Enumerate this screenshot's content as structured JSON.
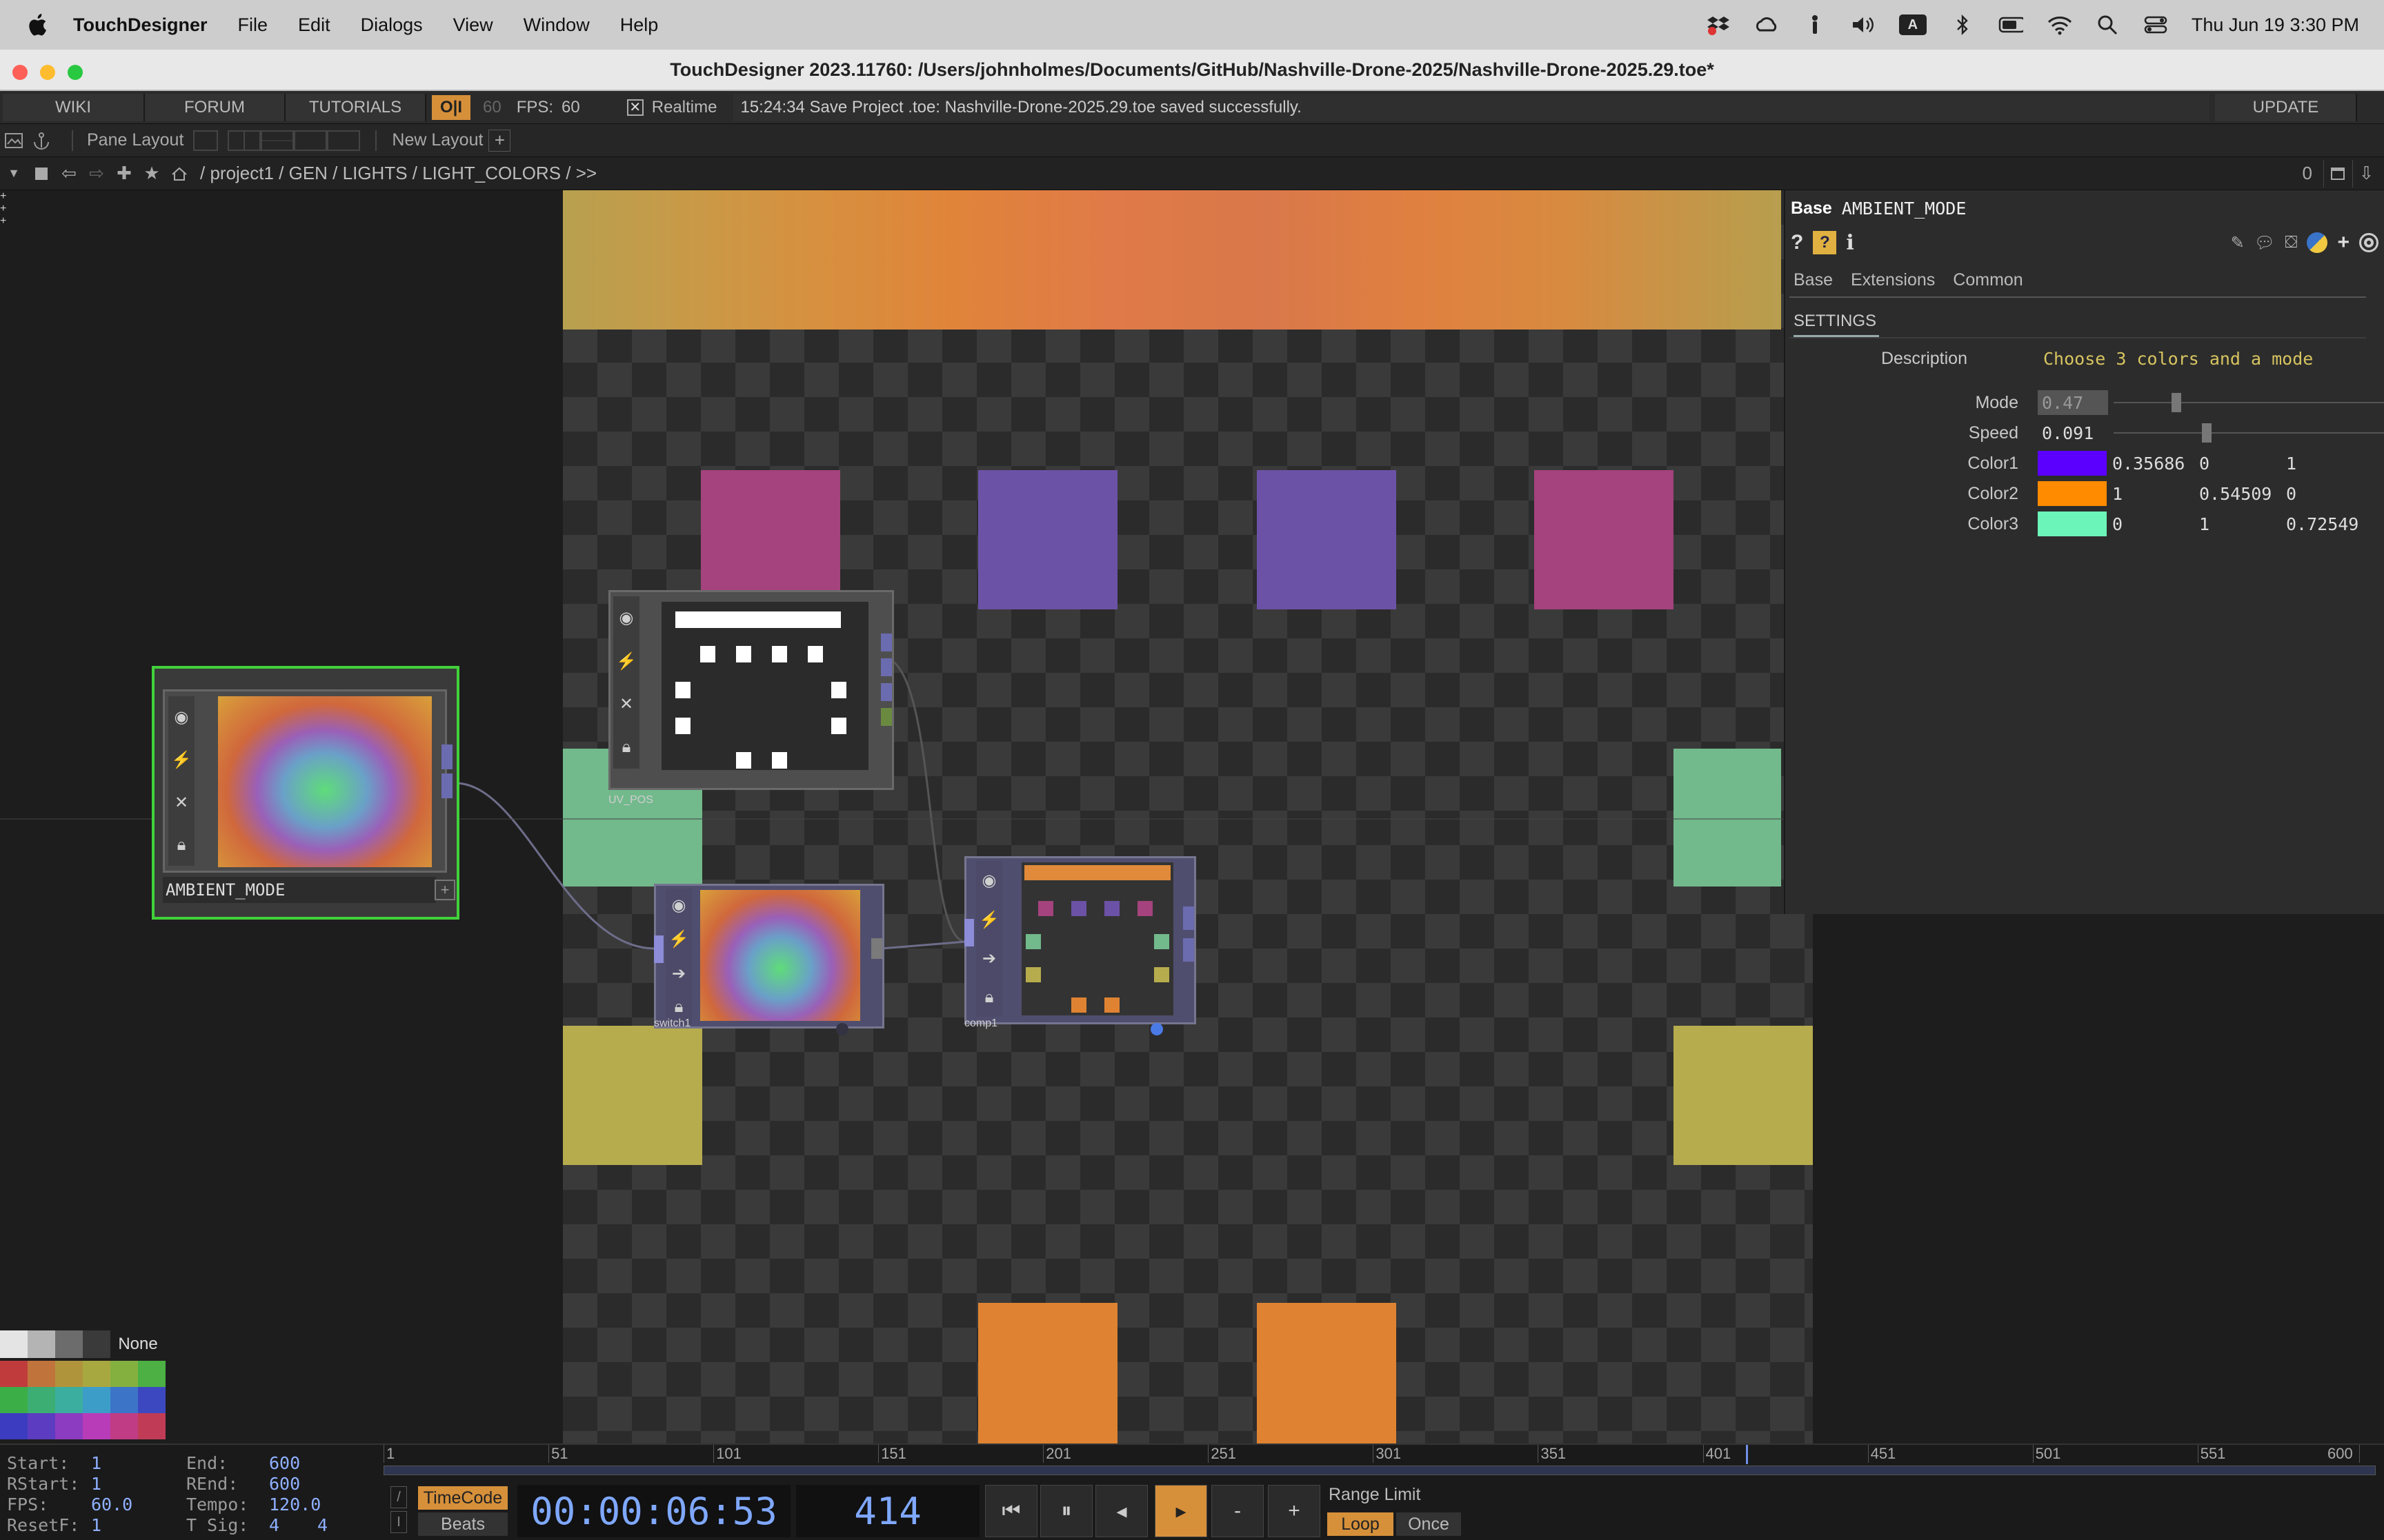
{
  "menubar": {
    "app": "TouchDesigner",
    "items": [
      "File",
      "Edit",
      "Dialogs",
      "View",
      "Window",
      "Help"
    ],
    "keyboard": "A",
    "datetime": "Thu Jun 19  3:30 PM"
  },
  "window": {
    "title": "TouchDesigner 2023.11760: /Users/johnholmes/Documents/GitHub/Nashville-Drone-2025/Nashville-Drone-2025.29.toe*"
  },
  "toolbar": {
    "wiki": "WIKI",
    "forum": "FORUM",
    "tutorials": "TUTORIALS",
    "oi": "O|I",
    "fps_cap": "60",
    "fps_label": "FPS:",
    "fps_value": "60",
    "realtime": "Realtime",
    "status": "15:24:34 Save Project .toe: Nashville-Drone-2025.29.toe saved successfully.",
    "update": "UPDATE"
  },
  "panebar": {
    "pane_layout": "Pane Layout",
    "new_layout": "New Layout"
  },
  "pathbar": {
    "path": "/ project1 / GEN / LIGHTS / LIGHT_COLORS / >>",
    "pane_index": "0"
  },
  "nodes": {
    "ambient": "AMBIENT_MODE",
    "uvpos": "UV_POS",
    "switch": "switch1",
    "comp": "comp1"
  },
  "params": {
    "type": "Base",
    "name": "AMBIENT_MODE",
    "tabs": [
      "Base",
      "Extensions",
      "Common"
    ],
    "page": "SETTINGS",
    "description_label": "Description",
    "description": "Choose 3 colors and a mode",
    "mode_label": "Mode",
    "mode": "0.47",
    "speed_label": "Speed",
    "speed": "0.091",
    "color1_label": "Color1",
    "color1": [
      "0.35686",
      "0",
      "1"
    ],
    "color1_hex": "#5b00ff",
    "color2_label": "Color2",
    "color2": [
      "1",
      "0.54509",
      "0"
    ],
    "color2_hex": "#ff8b00",
    "color3_label": "Color3",
    "color3": [
      "0",
      "1",
      "0.72549"
    ],
    "color3_hex": "#00ffb9"
  },
  "swatch_none": "None",
  "timeline": {
    "start_k": "Start:",
    "start": "1",
    "end_k": "End:",
    "end": "600",
    "rstart_k": "RStart:",
    "rstart": "1",
    "rend_k": "REnd:",
    "rend": "600",
    "fps_k": "FPS:",
    "fps": "60.0",
    "tempo_k": "Tempo:",
    "tempo": "120.0",
    "resetf_k": "ResetF:",
    "resetf": "1",
    "tsig_k": "T Sig:",
    "tsig_a": "4",
    "tsig_b": "4",
    "timecode_btn": "TimeCode",
    "beats_btn": "Beats",
    "timecode": "00:00:06:53",
    "frame": "414",
    "range_limit": "Range Limit",
    "loop": "Loop",
    "once": "Once",
    "ruler": [
      "1",
      "51",
      "101",
      "151",
      "201",
      "251",
      "301",
      "351",
      "401",
      "451",
      "501",
      "551",
      "600"
    ],
    "playhead_frame": 414
  }
}
